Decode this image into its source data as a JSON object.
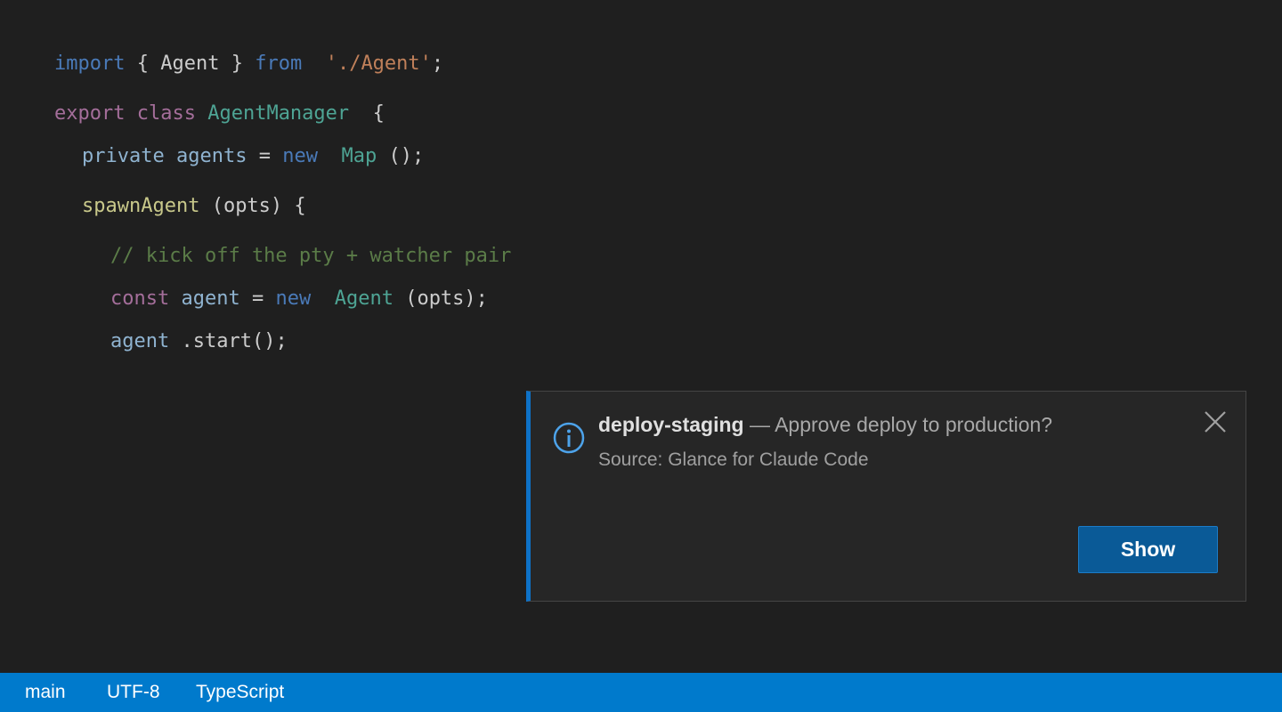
{
  "editor": {
    "lines": [
      [
        {
          "text": "import",
          "cls": "kw-blue"
        },
        {
          "text": " { ",
          "cls": "punct"
        },
        {
          "text": "Agent",
          "cls": "punct"
        },
        {
          "text": " } ",
          "cls": "punct"
        },
        {
          "text": "from",
          "cls": "kw-blue"
        },
        {
          "text": "  ",
          "cls": "punct"
        },
        {
          "text": "'./Agent'",
          "cls": "str"
        },
        {
          "text": ";",
          "cls": "punct"
        }
      ],
      [
        {
          "text": "export",
          "cls": "kw-purple"
        },
        {
          "text": " ",
          "cls": "punct"
        },
        {
          "text": "class",
          "cls": "kw-purple"
        },
        {
          "text": " ",
          "cls": "punct"
        },
        {
          "text": "AgentManager",
          "cls": "type-teal"
        },
        {
          "text": "  {",
          "cls": "punct"
        }
      ],
      [
        {
          "text": "private",
          "cls": "ident"
        },
        {
          "text": " ",
          "cls": "punct"
        },
        {
          "text": "agents",
          "cls": "ident"
        },
        {
          "text": " = ",
          "cls": "punct"
        },
        {
          "text": "new",
          "cls": "kw-blue"
        },
        {
          "text": "  ",
          "cls": "punct"
        },
        {
          "text": "Map",
          "cls": "type-teal"
        },
        {
          "text": " ();",
          "cls": "punct"
        }
      ],
      [
        {
          "text": "spawnAgent",
          "cls": "fn"
        },
        {
          "text": " (opts) {",
          "cls": "punct"
        }
      ],
      [
        {
          "text": "// kick off the pty + watcher pair",
          "cls": "comment"
        }
      ],
      [
        {
          "text": "const",
          "cls": "kw-purple"
        },
        {
          "text": " ",
          "cls": "punct"
        },
        {
          "text": "agent",
          "cls": "ident"
        },
        {
          "text": " = ",
          "cls": "punct"
        },
        {
          "text": "new",
          "cls": "kw-blue"
        },
        {
          "text": "  ",
          "cls": "punct"
        },
        {
          "text": "Agent",
          "cls": "type-teal"
        },
        {
          "text": " (opts);",
          "cls": "punct"
        }
      ],
      [
        {
          "text": "agent",
          "cls": "ident"
        },
        {
          "text": " .start();",
          "cls": "punct"
        }
      ]
    ]
  },
  "notification": {
    "title": "deploy-staging",
    "message": " — Approve deploy to production?",
    "source": "Source: Glance for Claude Code",
    "button_label": "Show",
    "icon": "info-icon",
    "close_icon": "close-icon",
    "accent_color": "#0e72c7"
  },
  "statusbar": {
    "branch": "main",
    "encoding": "UTF-8",
    "language": "TypeScript",
    "color": "#007acc"
  }
}
